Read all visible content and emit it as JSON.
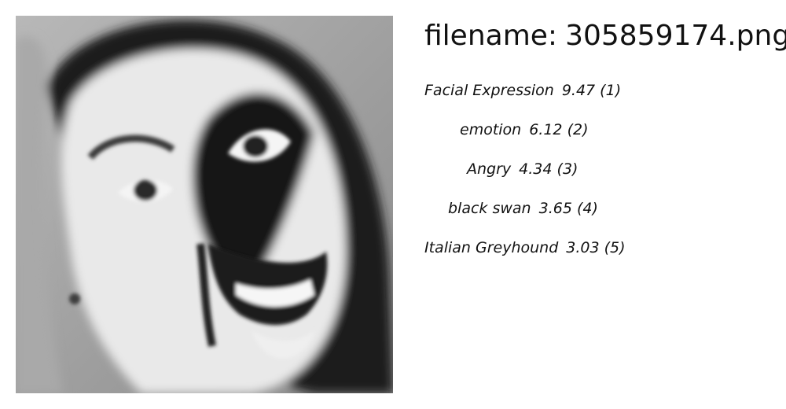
{
  "header": {
    "filename_prefix": "filename:",
    "filename": "305859174.png"
  },
  "image": {
    "kind": "grayscale face photo",
    "icon": "face-photo"
  },
  "labels": [
    {
      "name": "Facial Expression",
      "score": "9.47",
      "rank": "1"
    },
    {
      "name": "emotion",
      "score": "6.12",
      "rank": "2"
    },
    {
      "name": "Angry",
      "score": "4.34",
      "rank": "3"
    },
    {
      "name": "black swan",
      "score": "3.65",
      "rank": "4"
    },
    {
      "name": "Italian Greyhound",
      "score": "3.03",
      "rank": "5"
    }
  ]
}
